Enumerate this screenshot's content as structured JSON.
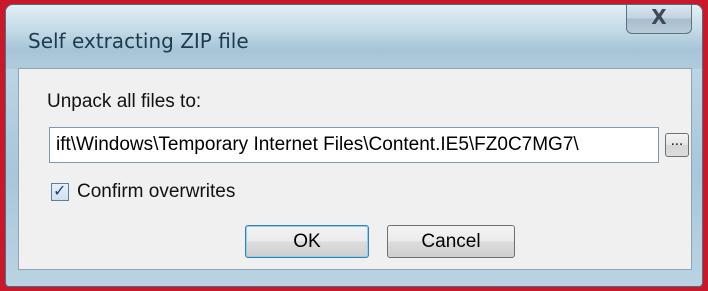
{
  "window": {
    "title": "Self extracting ZIP file",
    "close_glyph": "X"
  },
  "form": {
    "unpack_label": "Unpack all files to:",
    "path_value": "ift\\Windows\\Temporary Internet Files\\Content.IE5\\FZ0C7MG7\\",
    "browse_label": "...",
    "confirm_overwrites": {
      "label": "Confirm overwrites",
      "checked": true,
      "mark": "✓"
    }
  },
  "buttons": {
    "ok_label": "OK",
    "cancel_label": "Cancel"
  },
  "colors": {
    "background_border": "#c9182a",
    "title_text": "#1e3a4d",
    "checkbox_mark": "#1d3f7a"
  }
}
